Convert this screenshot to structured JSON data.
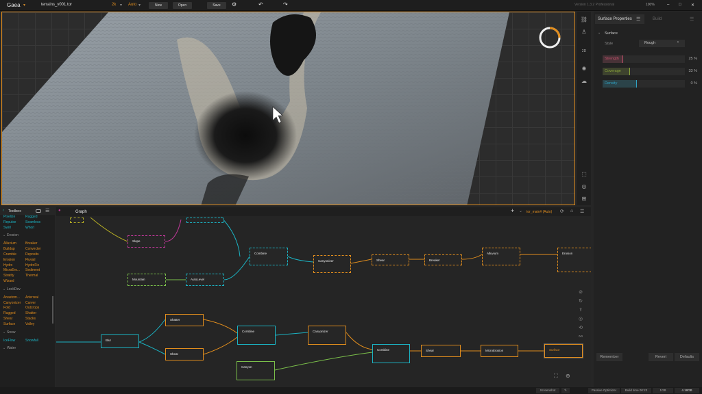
{
  "topbar": {
    "app_name": "Gaea",
    "file_name": "terrains_v001.tor",
    "resolution": "2k",
    "mode": "Auto",
    "new_label": "New",
    "open_label": "Open",
    "save_label": "Save",
    "version": "Version 1.3.2 Professional",
    "zoom": "100%"
  },
  "viewport": {
    "view_2d": "2D"
  },
  "right_panel": {
    "tab_properties": "Surface Properties",
    "tab_build": "Build",
    "section": "Surface",
    "style_label": "Style",
    "style_value": "Rough",
    "sliders": [
      {
        "label": "Strength",
        "value": "25 %",
        "fraction": 0.25,
        "color": "#c0506a"
      },
      {
        "label": "Coverage",
        "value": "33 %",
        "fraction": 0.33,
        "color": "#8aa63a"
      },
      {
        "label": "Density",
        "value": "0 %",
        "fraction": 0.42,
        "color": "#2fa3c4"
      }
    ],
    "remember": "Remember",
    "revert": "Revert",
    "defaults": "Defaults"
  },
  "toolbox": {
    "title": "Toolbox",
    "top_items": [
      [
        "Pixelize",
        "Rugged"
      ],
      [
        "Repulse",
        "Seamless"
      ],
      [
        "Swirl",
        "Whorl"
      ]
    ],
    "erosion_title": "Erosion",
    "erosion_items": [
      [
        "Alluvium",
        "Breaker"
      ],
      [
        "Buildup",
        "Convecter"
      ],
      [
        "Crumble",
        "Deposits"
      ],
      [
        "Erosion",
        "Fluvial"
      ],
      [
        "Hydro",
        "HydroFix"
      ],
      [
        "MicroEro...",
        "Sediment"
      ],
      [
        "Stratify",
        "Thermal"
      ],
      [
        "Wizard",
        ""
      ]
    ],
    "lookdev_title": "LookDev",
    "lookdev_items": [
      [
        "Anastom...",
        "Arterreal"
      ],
      [
        "Canyonizer",
        "Carver"
      ],
      [
        "Fold",
        "Outcrops"
      ],
      [
        "Rugged",
        "Shatter"
      ],
      [
        "Shear",
        "Stacks"
      ],
      [
        "Surface",
        "Valley"
      ]
    ],
    "snow_title": "Snow",
    "snow_items": [
      [
        "IceFlow",
        "Snowfall"
      ]
    ],
    "water_title": "Water"
  },
  "graph": {
    "tab": "Graph",
    "path": "tor_main# (Auto)",
    "nodes": {
      "slope": "Slope",
      "mountain": "Mountain",
      "autolevel": "AutoLevel",
      "combine1": "Combine",
      "canyonizer1": "Canyonizer",
      "shear1": "Shear",
      "breaker": "Breaker",
      "alluvium": "Alluvium",
      "erosion": "Erosion",
      "blur": "Blur",
      "shatter": "Shatter",
      "shear2": "Shear",
      "combine2": "Combine",
      "canyonizer2": "Canyonizer",
      "canyon": "Canyon",
      "combine3": "Combine",
      "shear3": "Shear",
      "microerosion": "MicroErosion",
      "surface": "Surface"
    }
  },
  "statusbar": {
    "screenshot": "Screenshot",
    "optimizer": "Passive Optimizer",
    "build_time": "Build time 00:23",
    "res": "1GB",
    "memory": "4.18GB"
  }
}
